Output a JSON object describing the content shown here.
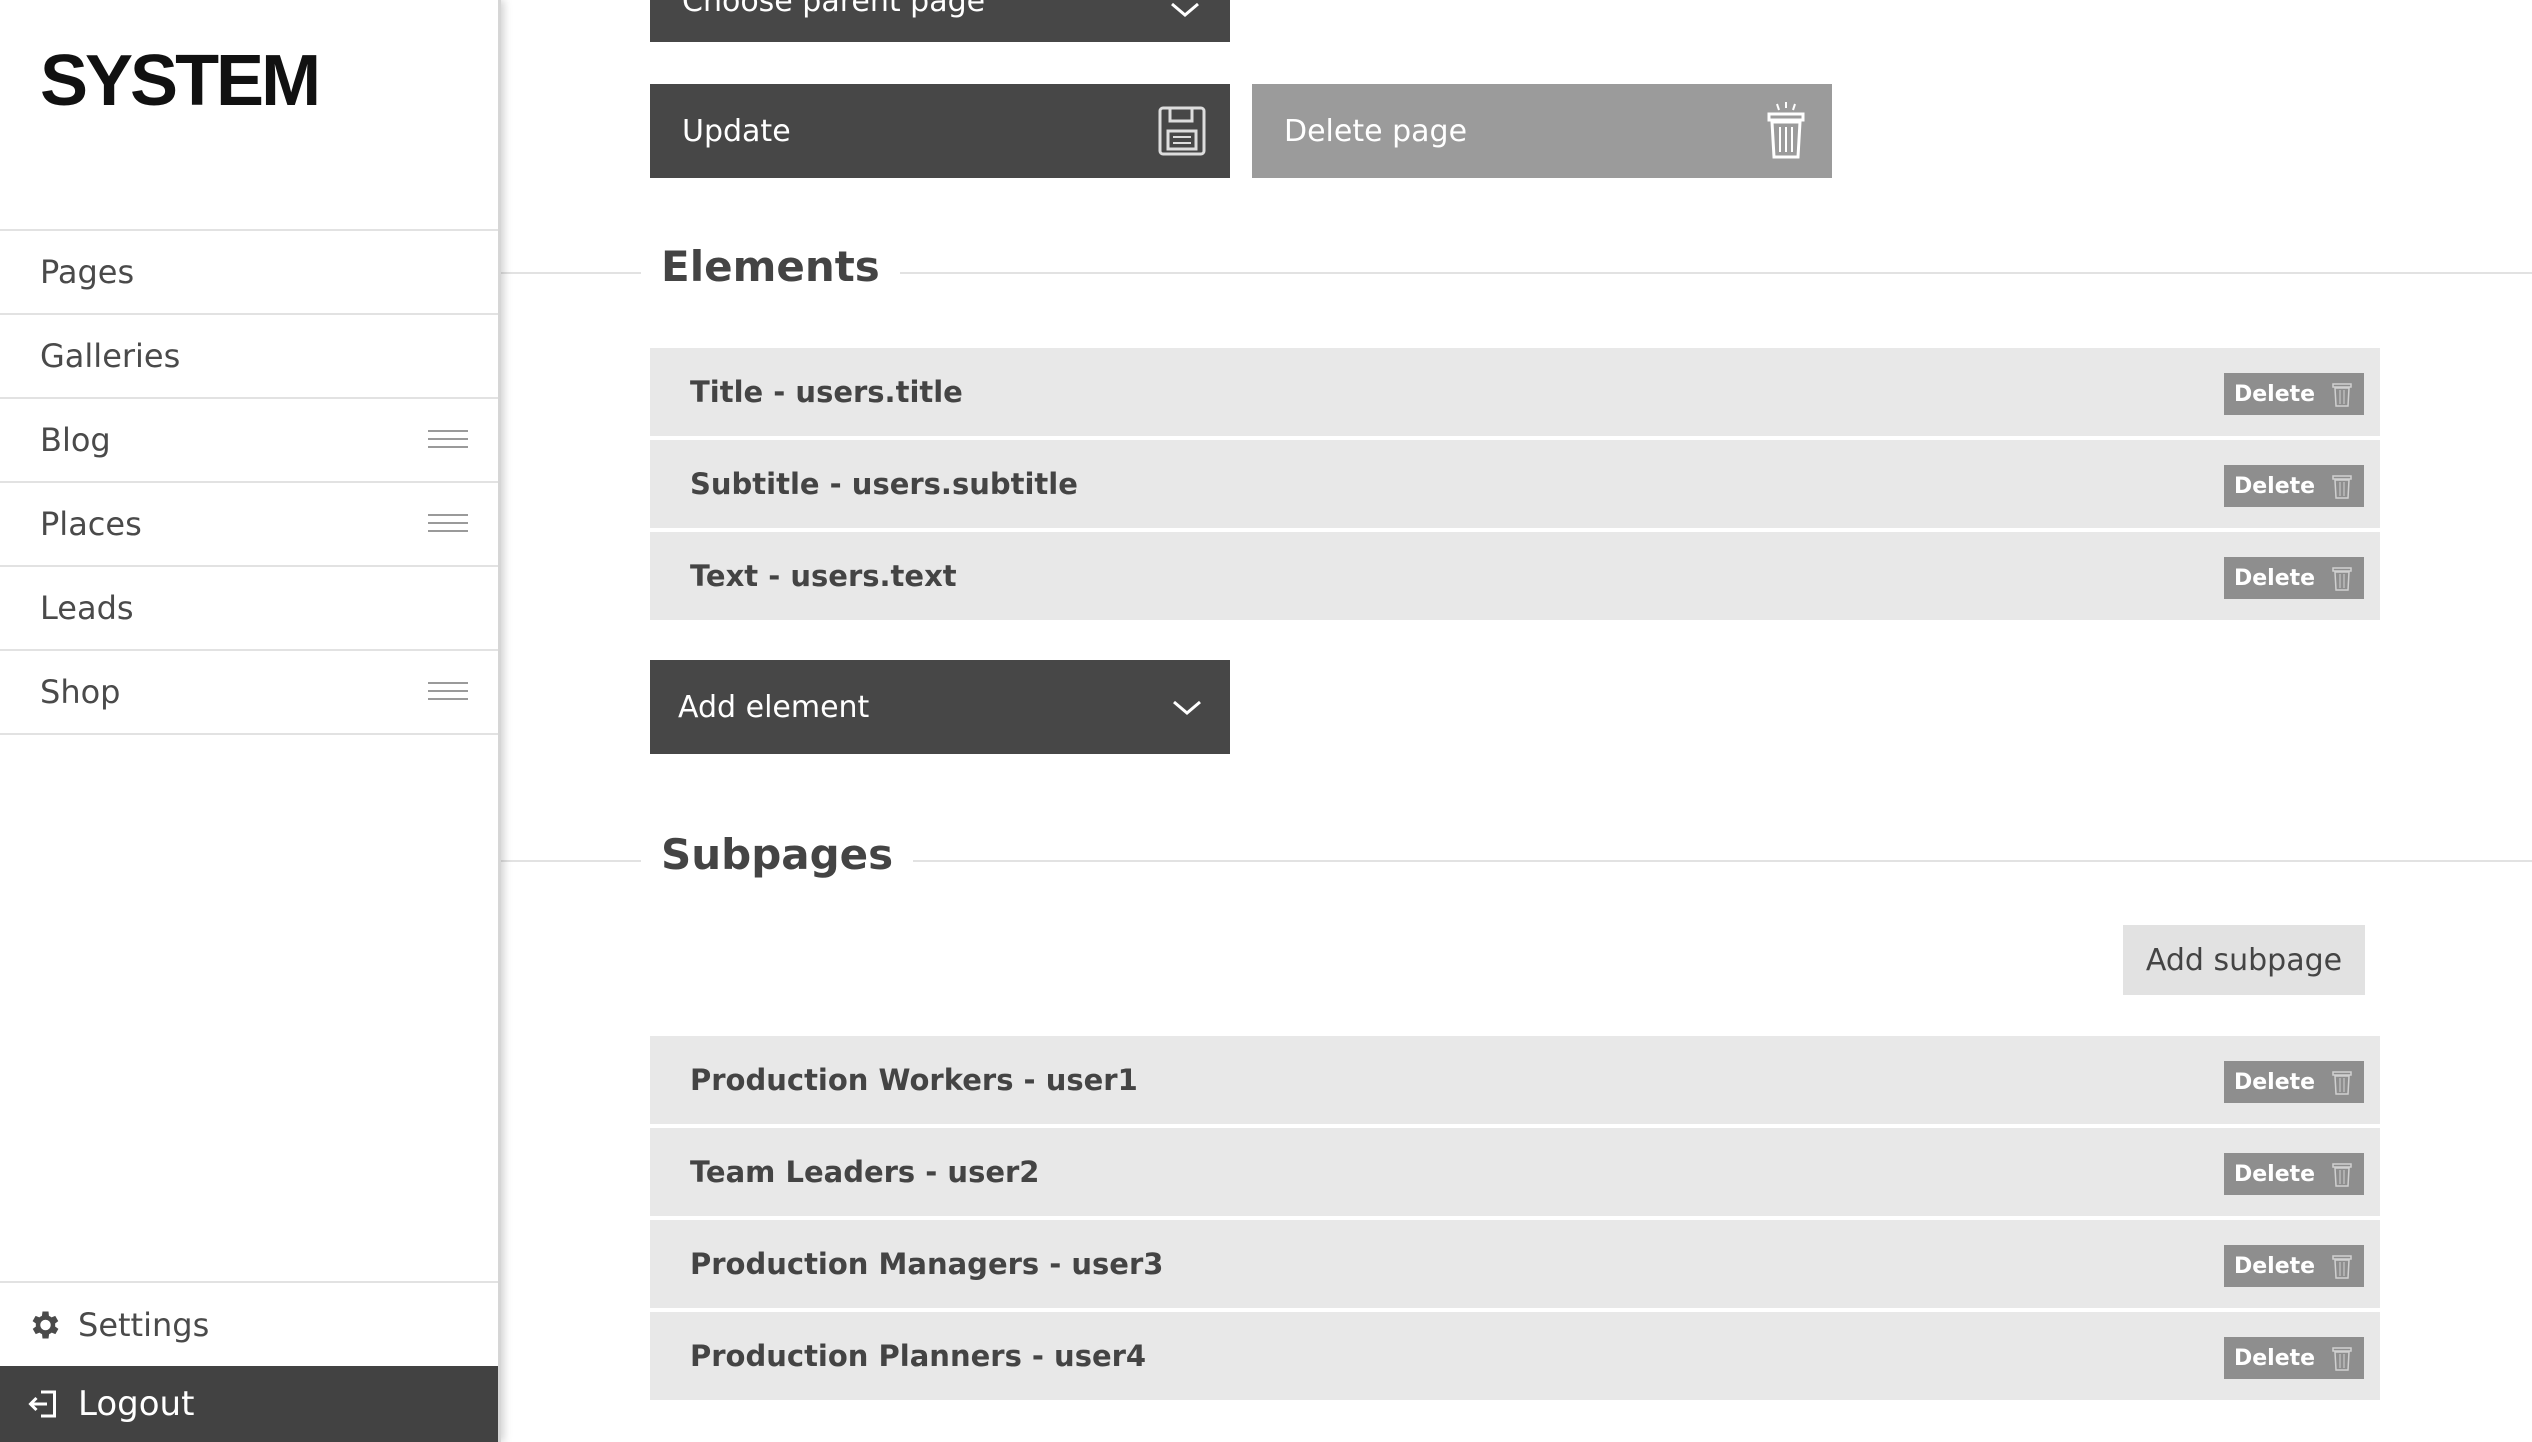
{
  "brand": {
    "logo": "SYSTEM"
  },
  "sidebar": {
    "items": [
      {
        "label": "Pages",
        "has_menu": false
      },
      {
        "label": "Galleries",
        "has_menu": false
      },
      {
        "label": "Blog",
        "has_menu": true
      },
      {
        "label": "Places",
        "has_menu": true
      },
      {
        "label": "Leads",
        "has_menu": false
      },
      {
        "label": "Shop",
        "has_menu": true
      }
    ],
    "settings_label": "Settings",
    "logout_label": "Logout"
  },
  "form": {
    "parent_select_label": "Choose parent page",
    "update_label": "Update",
    "delete_page_label": "Delete page"
  },
  "elements": {
    "heading": "Elements",
    "rows": [
      {
        "label": "Title - users.title",
        "delete_label": "Delete"
      },
      {
        "label": "Subtitle - users.subtitle",
        "delete_label": "Delete"
      },
      {
        "label": "Text - users.text",
        "delete_label": "Delete"
      }
    ],
    "add_label": "Add element"
  },
  "subpages": {
    "heading": "Subpages",
    "add_label": "Add subpage",
    "rows": [
      {
        "label": "Production Workers - user1",
        "delete_label": "Delete"
      },
      {
        "label": "Team Leaders - user2",
        "delete_label": "Delete"
      },
      {
        "label": "Production Managers - user3",
        "delete_label": "Delete"
      },
      {
        "label": "Production Planners - user4",
        "delete_label": "Delete"
      }
    ]
  },
  "colors": {
    "dark_button": "#474747",
    "grey_button": "#9b9b9b",
    "row_bg": "#e8e8e8",
    "delete_bg": "#8e8e8e",
    "logout_bg": "#424242"
  },
  "icons": {
    "menu": "hamburger-icon",
    "settings": "gear-icon",
    "logout": "logout-icon",
    "save": "floppy-disk-icon",
    "trash": "trash-icon",
    "chevron": "chevron-down-icon"
  }
}
